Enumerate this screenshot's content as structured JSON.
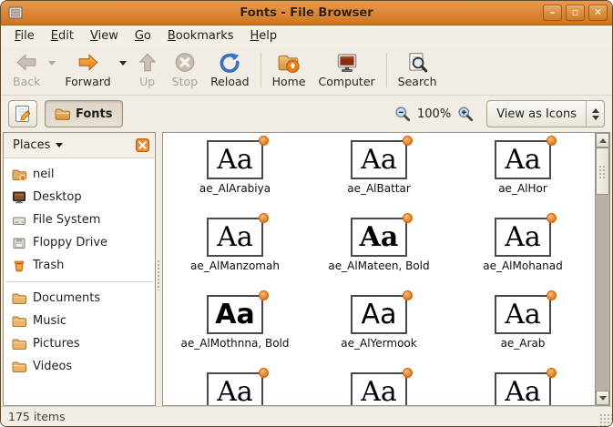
{
  "window": {
    "title": "Fonts - File Browser",
    "controls": {
      "minimize": "–",
      "maximize": "▫",
      "close": "✕"
    }
  },
  "colors": {
    "titlebar_orange": "#D9782D",
    "accent_orange": "#E8821E",
    "folder_orange": "#E9A64C",
    "reload_blue": "#3A6FC4"
  },
  "menubar": {
    "items": [
      "File",
      "Edit",
      "View",
      "Go",
      "Bookmarks",
      "Help"
    ]
  },
  "toolbar": {
    "back": "Back",
    "forward": "Forward",
    "up": "Up",
    "stop": "Stop",
    "reload": "Reload",
    "home": "Home",
    "computer": "Computer",
    "search": "Search"
  },
  "locationbar": {
    "path_button_label": "Fonts",
    "zoom_level": "100%",
    "view_mode_label": "View as Icons"
  },
  "sidebar": {
    "header_label": "Places",
    "items": [
      {
        "label": "neil",
        "icon": "home-folder-icon"
      },
      {
        "label": "Desktop",
        "icon": "desktop-icon"
      },
      {
        "label": "File System",
        "icon": "drive-icon"
      },
      {
        "label": "Floppy Drive",
        "icon": "floppy-icon"
      },
      {
        "label": "Trash",
        "icon": "trash-icon"
      },
      {
        "label": "Documents",
        "icon": "folder-icon"
      },
      {
        "label": "Music",
        "icon": "folder-icon"
      },
      {
        "label": "Pictures",
        "icon": "folder-icon"
      },
      {
        "label": "Videos",
        "icon": "folder-icon"
      }
    ]
  },
  "content": {
    "preview_glyph": "Aa",
    "fonts": [
      {
        "label": "ae_AlArabiya"
      },
      {
        "label": "ae_AlBattar"
      },
      {
        "label": "ae_AlHor"
      },
      {
        "label": "ae_AlManzomah"
      },
      {
        "label": "ae_AlMateen, Bold"
      },
      {
        "label": "ae_AlMohanad"
      },
      {
        "label": "ae_AlMothnna, Bold"
      },
      {
        "label": "ae_AlYermook"
      },
      {
        "label": "ae_Arab"
      }
    ]
  },
  "statusbar": {
    "items_count": "175 items"
  }
}
